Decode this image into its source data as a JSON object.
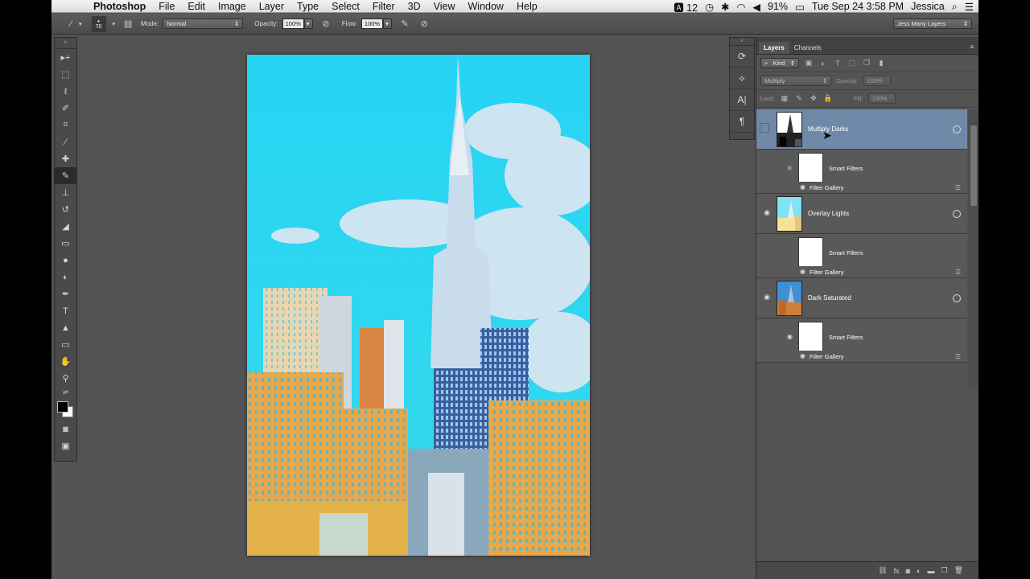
{
  "menubar": {
    "app_name": "Photoshop",
    "items": [
      "File",
      "Edit",
      "Image",
      "Layer",
      "Type",
      "Select",
      "Filter",
      "3D",
      "View",
      "Window",
      "Help"
    ],
    "status": {
      "adobe_badge": "12",
      "battery": "91%",
      "datetime": "Tue Sep 24  3:58 PM",
      "user": "Jessica"
    }
  },
  "options_bar": {
    "brush_size": "70",
    "mode_label": "Mode:",
    "mode_value": "Normal",
    "opacity_label": "Opacity:",
    "opacity_value": "100%",
    "flow_label": "Flow:",
    "flow_value": "100%",
    "workspace": "Jess Many Layers"
  },
  "tools": [
    "move-tool",
    "marquee-tool",
    "lasso-tool",
    "quick-selection-tool",
    "crop-tool",
    "eyedropper-tool",
    "healing-brush-tool",
    "brush-tool",
    "clone-stamp-tool",
    "history-brush-tool",
    "eraser-tool",
    "gradient-tool",
    "blur-tool",
    "dodge-tool",
    "pen-tool",
    "type-tool",
    "path-selection-tool",
    "rectangle-tool",
    "hand-tool",
    "zoom-tool"
  ],
  "layers_panel": {
    "tabs": [
      "Layers",
      "Channels"
    ],
    "filter_kind": "Kind",
    "blend_mode": "Multiply",
    "opacity_label": "Opacity:",
    "opacity_value": "100%",
    "lock_label": "Lock:",
    "fill_label": "Fill:",
    "fill_value": "100%",
    "layers": [
      {
        "name": "Multiply Darks",
        "selected": true,
        "visible": false,
        "smart_filters": "Smart Filters",
        "filter": "Filter Gallery"
      },
      {
        "name": "Overlay Lights",
        "selected": false,
        "visible": true,
        "smart_filters": "Smart Filters",
        "filter": "Filter Gallery"
      },
      {
        "name": "Dark Saturated",
        "selected": false,
        "visible": true,
        "smart_filters": "Smart Filters",
        "filter": "Filter Gallery"
      }
    ]
  },
  "colors": {
    "sky": "#2dd6f0",
    "building_orange": "#e9a84a",
    "panel_bg": "#535353",
    "selection": "#7189a8"
  }
}
